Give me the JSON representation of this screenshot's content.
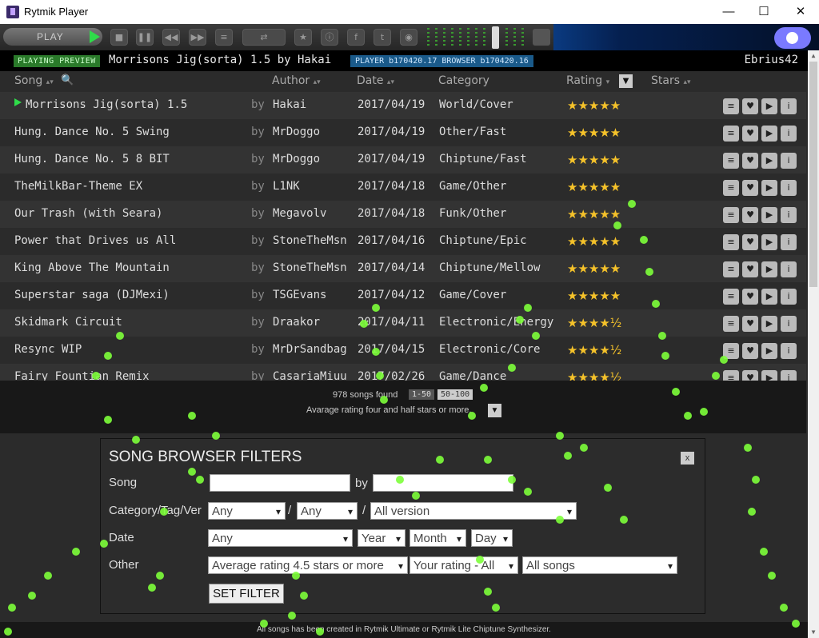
{
  "window": {
    "title": "Rytmik Player"
  },
  "toolbar": {
    "play_label": "PLAY"
  },
  "now_playing": {
    "badge": "PLAYING PREVIEW",
    "title": "Morrisons Jig(sorta) 1.5 by Hakai",
    "version": "PLAYER b170420.17 BROWSER b170420.16",
    "user": "Ebrius42"
  },
  "columns": {
    "song": "Song",
    "author": "Author",
    "date": "Date",
    "category": "Category",
    "rating": "Rating",
    "stars": "Stars"
  },
  "songs": [
    {
      "title": "Morrisons Jig(sorta) 1.5",
      "by": "by",
      "author": "Hakai",
      "date": "2017/04/19",
      "category": "World/Cover",
      "stars": "★★★★★",
      "playing": true
    },
    {
      "title": "Hung. Dance No. 5 Swing",
      "by": "by",
      "author": "MrDoggo",
      "date": "2017/04/19",
      "category": "Other/Fast",
      "stars": "★★★★★"
    },
    {
      "title": "Hung. Dance No. 5 8 BIT",
      "by": "by",
      "author": "MrDoggo",
      "date": "2017/04/19",
      "category": "Chiptune/Fast",
      "stars": "★★★★★"
    },
    {
      "title": "TheMilkBar-Theme EX",
      "by": "by",
      "author": "L1NK",
      "date": "2017/04/18",
      "category": "Game/Other",
      "stars": "★★★★★"
    },
    {
      "title": "Our Trash (with Seara)",
      "by": "by",
      "author": "Megavolv",
      "date": "2017/04/18",
      "category": "Funk/Other",
      "stars": "★★★★★"
    },
    {
      "title": "Power that Drives us All",
      "by": "by",
      "author": "StoneTheMsn",
      "date": "2017/04/16",
      "category": "Chiptune/Epic",
      "stars": "★★★★★"
    },
    {
      "title": "King Above The Mountain",
      "by": "by",
      "author": "StoneTheMsn",
      "date": "2017/04/14",
      "category": "Chiptune/Mellow",
      "stars": "★★★★★"
    },
    {
      "title": "Superstar saga (DJMexi)",
      "by": "by",
      "author": "TSGEvans",
      "date": "2017/04/12",
      "category": "Game/Cover",
      "stars": "★★★★★"
    },
    {
      "title": "Skidmark Circuit",
      "by": "by",
      "author": "Draakor",
      "date": "2017/04/11",
      "category": "Electronic/Energy",
      "stars": "★★★★½"
    },
    {
      "title": "Resync WIP",
      "by": "by",
      "author": "MrDrSandbag",
      "date": "2017/04/15",
      "category": "Electronic/Core",
      "stars": "★★★★½"
    },
    {
      "title": "Fairy Fountian Remix",
      "by": "by",
      "author": "CasariaMiuu",
      "date": "2017/02/26",
      "category": "Game/Dance",
      "stars": "★★★★½"
    }
  ],
  "row_actions": [
    {
      "icon": "add-to-playlist-icon",
      "glyph": "≡"
    },
    {
      "icon": "heart-icon",
      "glyph": "♥"
    },
    {
      "icon": "play-icon",
      "glyph": "▶"
    },
    {
      "icon": "info-icon",
      "glyph": "i"
    }
  ],
  "list_info": {
    "songs_found": "978 songs found",
    "page_current": "1-50",
    "page_next": "50-100",
    "avg_note": "Avarage rating four and half stars or more."
  },
  "filters": {
    "title": "SONG BROWSER FILTERS",
    "close": "x",
    "song_label": "Song",
    "by_label": "by",
    "song_value": "",
    "author_value": "",
    "category_label": "Category/Tag/Ver",
    "category": "Any",
    "tag": "Any",
    "version": "All version",
    "date_label": "Date",
    "date": "Any",
    "year": "Year",
    "month": "Month",
    "day": "Day",
    "other_label": "Other",
    "avg_rating": "Average rating 4.5 stars or more",
    "your_rating": "Your rating - All",
    "songs_scope": "All songs",
    "set_button": "SET FILTER",
    "sep1": "/",
    "sep2": "/"
  },
  "footer": "All songs has been created in Rytmik Ultimate or Rytmik Lite Chiptune Synthesizer.",
  "colors": {
    "accent_green": "#2fdc4a",
    "star_gold": "#f5c22a",
    "particle": "#7dff3a"
  }
}
